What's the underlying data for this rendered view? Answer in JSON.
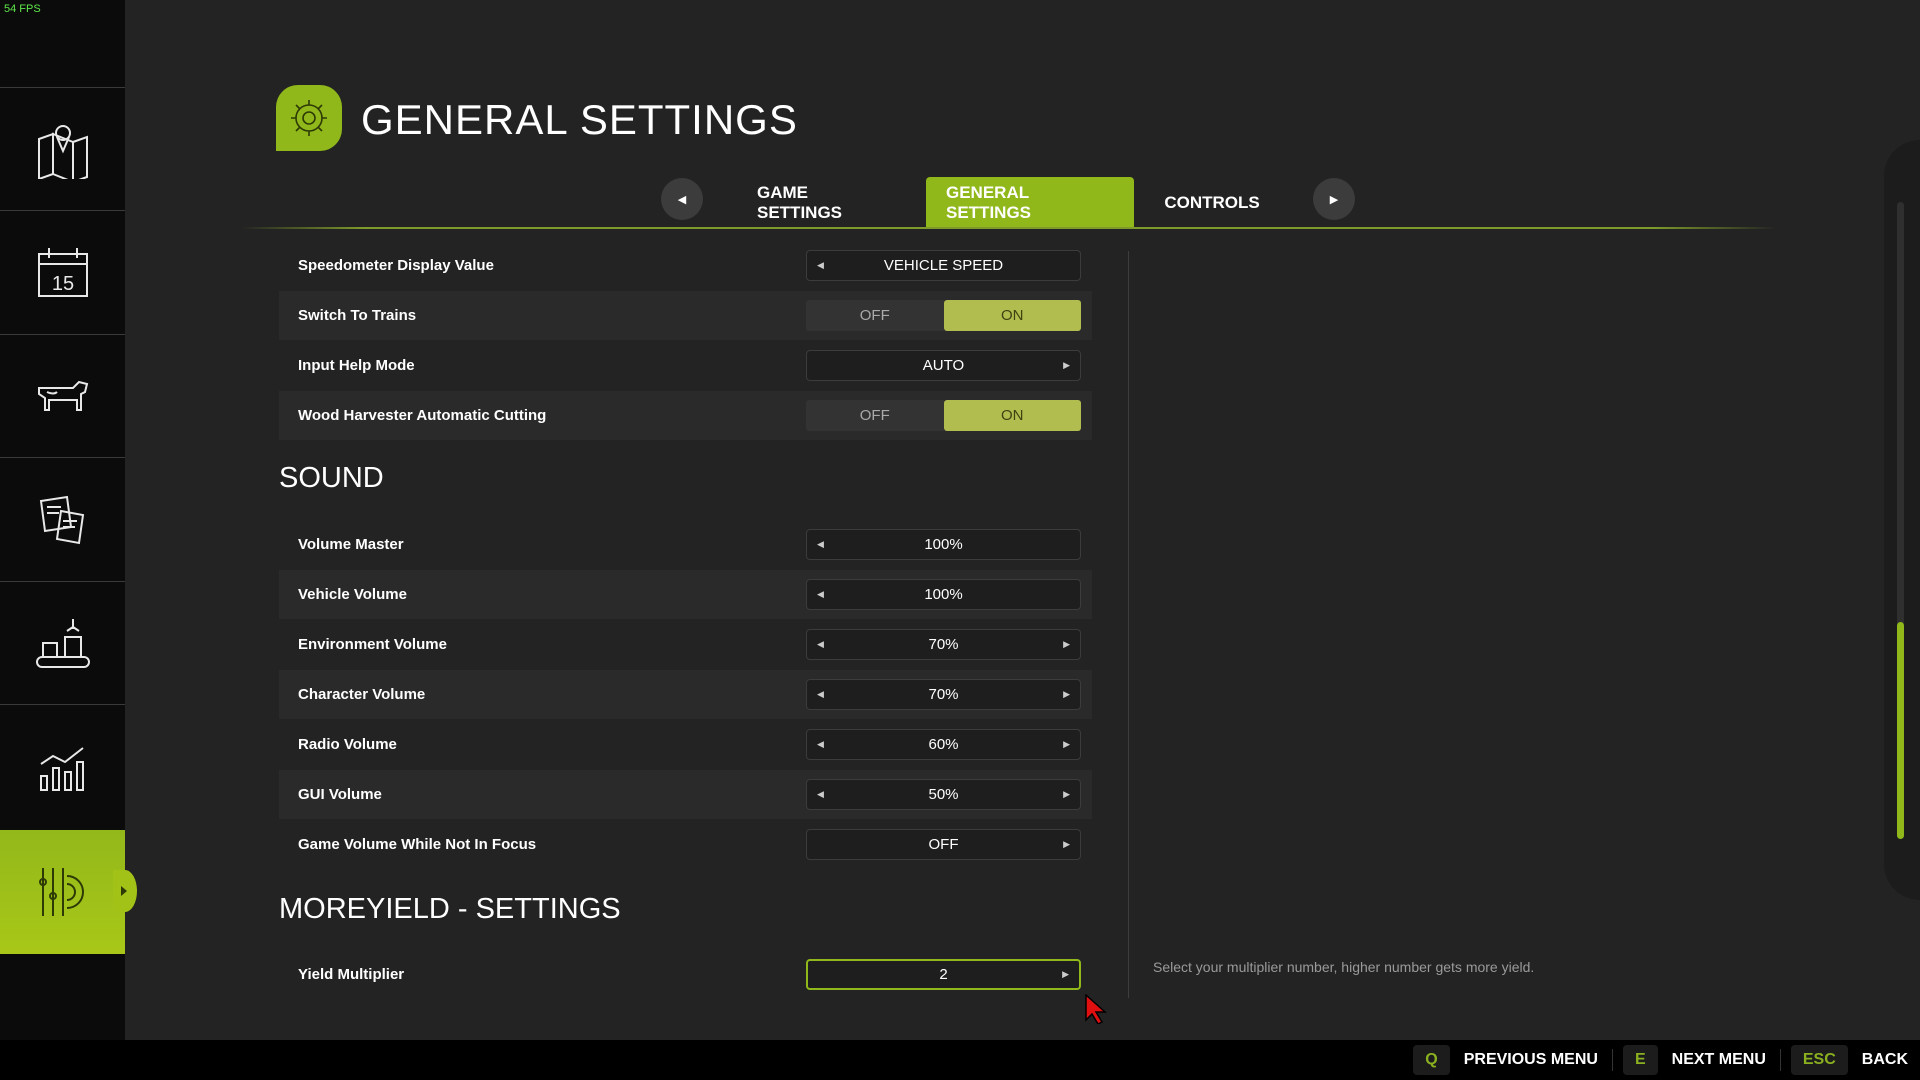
{
  "fps": "54 FPS",
  "sidebar": {
    "items": [
      {
        "icon": "map-icon"
      },
      {
        "icon": "calendar-icon",
        "label": "15"
      },
      {
        "icon": "cow-icon"
      },
      {
        "icon": "contracts-icon"
      },
      {
        "icon": "production-icon"
      },
      {
        "icon": "statistics-icon"
      },
      {
        "icon": "settings-icon",
        "active": true
      }
    ]
  },
  "header": {
    "title": "GENERAL SETTINGS",
    "icon": "gear-icon",
    "accent": "#90b81b"
  },
  "tabs": [
    {
      "label": "GAME SETTINGS"
    },
    {
      "label": "GENERAL SETTINGS",
      "active": true
    },
    {
      "label": "CONTROLS"
    }
  ],
  "general": [
    {
      "label": "Speedometer Display Value",
      "type": "selector",
      "value": "VEHICLE SPEED",
      "left": true,
      "right": false
    },
    {
      "label": "Switch To Trains",
      "type": "toggle",
      "off": "OFF",
      "on": "ON",
      "value": "ON"
    },
    {
      "label": "Input Help Mode",
      "type": "selector",
      "value": "AUTO",
      "left": false,
      "right": true
    },
    {
      "label": "Wood Harvester Automatic Cutting",
      "type": "toggle",
      "off": "OFF",
      "on": "ON",
      "value": "ON"
    }
  ],
  "sound": {
    "title": "SOUND",
    "rows": [
      {
        "label": "Volume Master",
        "type": "selector",
        "value": "100%",
        "left": true,
        "right": false
      },
      {
        "label": "Vehicle Volume",
        "type": "selector",
        "value": "100%",
        "left": true,
        "right": false
      },
      {
        "label": "Environment Volume",
        "type": "selector",
        "value": "70%",
        "left": true,
        "right": true
      },
      {
        "label": "Character Volume",
        "type": "selector",
        "value": "70%",
        "left": true,
        "right": true
      },
      {
        "label": "Radio Volume",
        "type": "selector",
        "value": "60%",
        "left": true,
        "right": true
      },
      {
        "label": "GUI Volume",
        "type": "selector",
        "value": "50%",
        "left": true,
        "right": true
      },
      {
        "label": "Game Volume While Not In Focus",
        "type": "selector",
        "value": "OFF",
        "left": false,
        "right": true
      }
    ]
  },
  "moreyield": {
    "title": "MOREYIELD - SETTINGS",
    "rows": [
      {
        "label": "Yield Multiplier",
        "type": "selector",
        "value": "2",
        "left": false,
        "right": true,
        "focused": true
      }
    ]
  },
  "description": "Select your multiplier number, higher number gets more yield.",
  "footer": [
    {
      "key": "Q",
      "label": "PREVIOUS MENU"
    },
    {
      "key": "E",
      "label": "NEXT MENU"
    },
    {
      "key": "ESC",
      "label": "BACK"
    }
  ]
}
